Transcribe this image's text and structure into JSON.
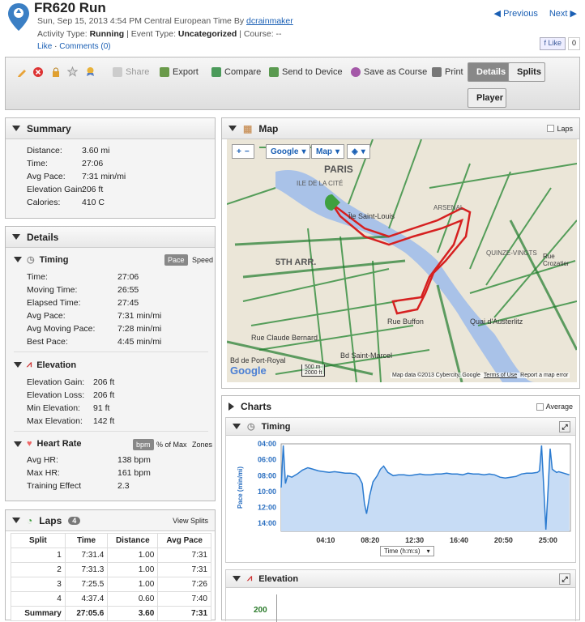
{
  "header": {
    "title": "FR620 Run",
    "date": "Sun, Sep 15, 2013 4:54 PM Central European Time By",
    "user": "dcrainmaker",
    "activity_type_label": "Activity Type:",
    "activity_type": "Running",
    "event_type_label": "| Event Type:",
    "event_type": "Uncategorized",
    "course": "| Course: --",
    "like": "Like",
    "comments": "Comments (0)",
    "prev": "Previous",
    "next": "Next",
    "fb_like": "Like",
    "fb_count": "0"
  },
  "toolbar": {
    "share": "Share",
    "export": "Export",
    "compare": "Compare",
    "send": "Send to Device",
    "save_course": "Save as Course",
    "print": "Print",
    "details": "Details",
    "splits": "Splits",
    "player": "Player"
  },
  "summary": {
    "title": "Summary",
    "rows": [
      {
        "label": "Distance:",
        "value": "3.60 mi"
      },
      {
        "label": "Time:",
        "value": "27:06"
      },
      {
        "label": "Avg Pace:",
        "value": "7:31 min/mi"
      },
      {
        "label": "Elevation Gain:",
        "value": "206 ft"
      },
      {
        "label": "Calories:",
        "value": "410 C"
      }
    ]
  },
  "details": {
    "title": "Details",
    "timing": {
      "title": "Timing",
      "pace": "Pace",
      "speed": "Speed",
      "rows": [
        {
          "label": "Time:",
          "value": "27:06"
        },
        {
          "label": "Moving Time:",
          "value": "26:55"
        },
        {
          "label": "Elapsed Time:",
          "value": "27:45"
        },
        {
          "label": "Avg Pace:",
          "value": "7:31 min/mi"
        },
        {
          "label": "Avg Moving Pace:",
          "value": "7:28 min/mi"
        },
        {
          "label": "Best Pace:",
          "value": "4:45 min/mi"
        }
      ]
    },
    "elevation": {
      "title": "Elevation",
      "rows": [
        {
          "label": "Elevation Gain:",
          "value": "206 ft"
        },
        {
          "label": "Elevation Loss:",
          "value": "206 ft"
        },
        {
          "label": "Min Elevation:",
          "value": "91 ft"
        },
        {
          "label": "Max Elevation:",
          "value": "142 ft"
        }
      ]
    },
    "heart": {
      "title": "Heart Rate",
      "bpm": "bpm",
      "pct": "% of Max",
      "zones": "Zones",
      "rows": [
        {
          "label": "Avg HR:",
          "value": "138 bpm"
        },
        {
          "label": "Max HR:",
          "value": "161 bpm"
        },
        {
          "label": "Training Effect",
          "value": "2.3"
        }
      ]
    }
  },
  "laps": {
    "title": "Laps",
    "count": "4",
    "view_splits": "View Splits",
    "headers": [
      "Split",
      "Time",
      "Distance",
      "Avg Pace"
    ],
    "rows": [
      [
        "1",
        "7:31.4",
        "1.00",
        "7:31"
      ],
      [
        "2",
        "7:31.3",
        "1.00",
        "7:31"
      ],
      [
        "3",
        "7:25.5",
        "1.00",
        "7:26"
      ],
      [
        "4",
        "4:37.4",
        "0.60",
        "7:40"
      ]
    ],
    "summary": [
      "Summary",
      "27:05.6",
      "3.60",
      "7:31"
    ]
  },
  "map": {
    "title": "Map",
    "laps": "Laps",
    "google": "Google",
    "maptype": "Map",
    "labels": [
      "PARIS",
      "ILE DE LA CITÉ",
      "Île Saint-Louis",
      "5TH ARR.",
      "ARSENAL",
      "QUINZE-VINGTS",
      "Rue Buffon",
      "Bd Saint-Marcel",
      "Rue Claude Bernard",
      "Bd de Port-Royal",
      "Quai d'Austerlitz",
      "Rue Crozatier"
    ],
    "scale_m": "500 m",
    "scale_ft": "2000 ft",
    "attribution": "Map data ©2013 Cybercity, Google",
    "terms": "Terms of Use",
    "report": "Report a map error",
    "logo": "Google"
  },
  "charts": {
    "title": "Charts",
    "average": "Average",
    "timing_title": "Timing",
    "elevation_title": "Elevation",
    "time_select": "Time (h:m:s)",
    "elev_tick": "200"
  },
  "chart_data": {
    "type": "area",
    "ylabel": "Pace (min/mi)",
    "xlabel": "Time (h:m:s)",
    "y_ticks": [
      "04:00",
      "06:00",
      "08:00",
      "10:00",
      "12:00",
      "14:00"
    ],
    "x_ticks": [
      "04:10",
      "08:20",
      "12:30",
      "16:40",
      "20:50",
      "25:00"
    ],
    "ylim": [
      4,
      15
    ],
    "y_inverted": true,
    "series": [
      {
        "x": [
          0,
          0.2,
          0.4,
          0.6,
          1,
          1.5,
          2,
          2.5,
          3,
          3.5,
          4,
          4.5,
          5,
          5.5,
          6,
          6.5,
          7,
          7.3,
          7.6,
          7.8,
          8,
          8.3,
          8.6,
          9,
          9.3,
          9.6,
          10,
          10.5,
          11,
          11.5,
          12,
          12.5,
          13,
          13.5,
          14,
          14.5,
          15,
          15.5,
          16,
          16.5,
          17,
          17.5,
          18,
          18.5,
          19,
          19.5,
          20,
          20.5,
          21,
          21.5,
          22,
          22.5,
          23,
          23.5,
          24,
          24.2,
          24.4,
          24.6,
          24.8,
          25,
          25.2,
          25.4,
          25.6,
          25.8,
          26,
          26.5,
          27
        ],
        "y": [
          9.5,
          4.2,
          9,
          8,
          8.2,
          7.8,
          7.3,
          7.0,
          7.2,
          7.4,
          7.5,
          7.6,
          7.5,
          7.6,
          7.7,
          7.7,
          7.8,
          8.2,
          9.0,
          11.5,
          12.8,
          10.5,
          8.8,
          8.0,
          7.2,
          6.8,
          7.6,
          8.0,
          7.9,
          7.9,
          8.0,
          7.9,
          7.8,
          7.9,
          7.9,
          7.8,
          7.8,
          7.7,
          7.8,
          7.8,
          7.9,
          7.7,
          7.8,
          7.8,
          7.9,
          7.8,
          7.9,
          8.2,
          8.3,
          8.2,
          8.1,
          7.8,
          7.7,
          7.7,
          7.6,
          7.4,
          4.2,
          9.5,
          14.8,
          10.0,
          4.6,
          7.2,
          7.4,
          7.6,
          7.5,
          7.7,
          7.9
        ]
      }
    ]
  }
}
